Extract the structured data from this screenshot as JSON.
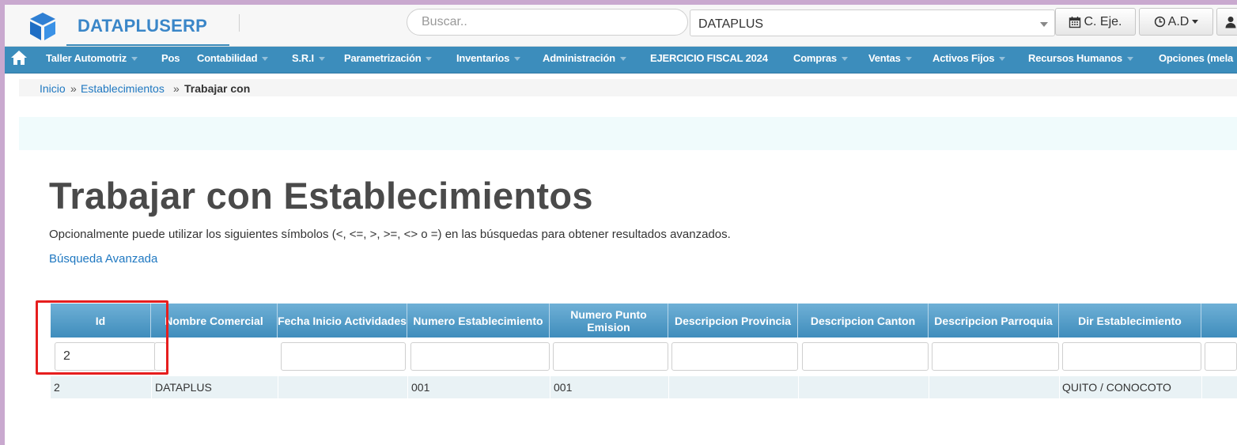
{
  "header": {
    "brand": "DATAPLUSERP",
    "search_placeholder": "Buscar..",
    "company_select": "DATAPLUS",
    "btn_ceje": "C. Eje.",
    "btn_ad": "A.D"
  },
  "nav": {
    "items": [
      "Taller Automotriz",
      "Pos",
      "Contabilidad",
      "S.R.I",
      "Parametrización",
      "Inventarios",
      "Administración",
      "EJERCICIO FISCAL 2024",
      "Compras",
      "Ventas",
      "Activos Fijos",
      "Recursos Humanos",
      "Opciones (mela"
    ]
  },
  "breadcrumb": {
    "home": "Inicio",
    "sep": "»",
    "section": "Establecimientos",
    "current": "Trabajar con"
  },
  "page": {
    "title": "Trabajar con Establecimientos",
    "hint": "Opcionalmente puede utilizar los siguientes símbolos (<, <=, >, >=, <> o =) en las búsquedas para obtener resultados avanzados.",
    "advanced_link": "Búsqueda Avanzada"
  },
  "grid": {
    "headers": [
      "Id",
      "Nombre Comercial",
      "Fecha Inicio Actividades",
      "Numero Establecimiento",
      "Numero Punto Emision",
      "Descripcion Provincia",
      "Descripcion Canton",
      "Descripcion Parroquia",
      "Dir Establecimiento",
      ""
    ],
    "filters": [
      "2",
      "",
      "",
      "",
      "",
      "",
      "",
      "",
      "",
      ""
    ],
    "rows": [
      [
        "2",
        "DATAPLUS",
        "",
        "001",
        "001",
        "",
        "",
        "",
        "QUITO / CONOCOTO",
        ""
      ]
    ]
  },
  "colors": {
    "accent": "#3c8dbc",
    "highlight": "#e61e1e",
    "link": "#1f78c1"
  }
}
